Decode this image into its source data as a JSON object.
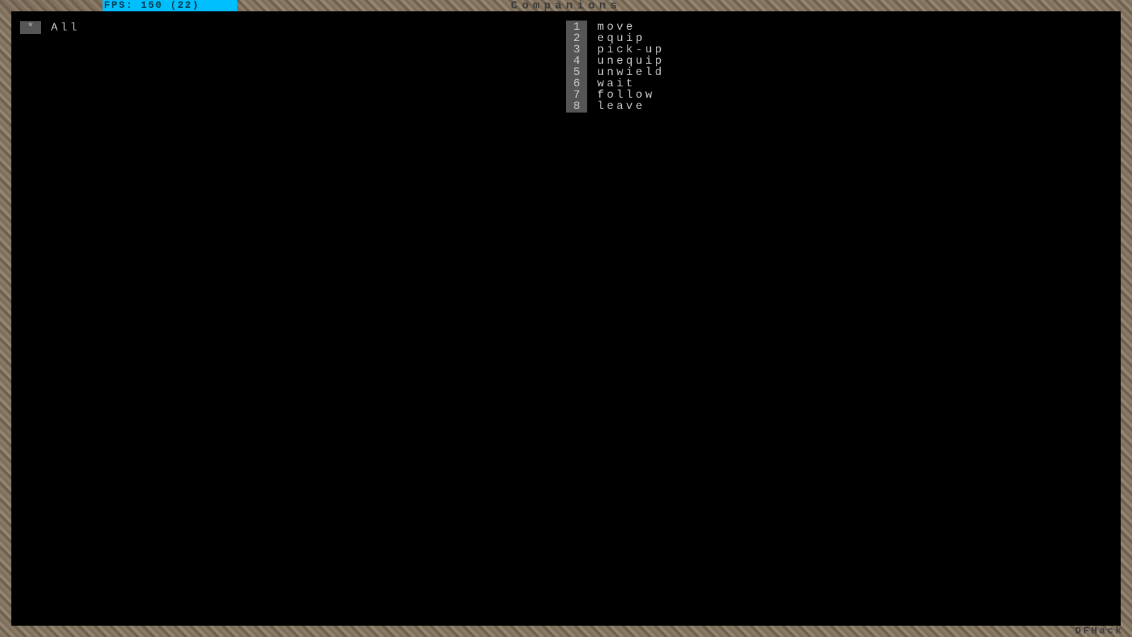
{
  "topbar": {
    "fps_text": "FPS: 150 (22)",
    "title": "Companions"
  },
  "left": {
    "selector_glyph": "*",
    "all_label": "All"
  },
  "actions": [
    {
      "key": "1",
      "label": "move"
    },
    {
      "key": "2",
      "label": "equip"
    },
    {
      "key": "3",
      "label": "pick-up"
    },
    {
      "key": "4",
      "label": "unequip"
    },
    {
      "key": "5",
      "label": "unwield"
    },
    {
      "key": "6",
      "label": "wait"
    },
    {
      "key": "7",
      "label": "follow"
    },
    {
      "key": "8",
      "label": "leave"
    }
  ],
  "footer": {
    "dfhack_label": "DFHack"
  }
}
